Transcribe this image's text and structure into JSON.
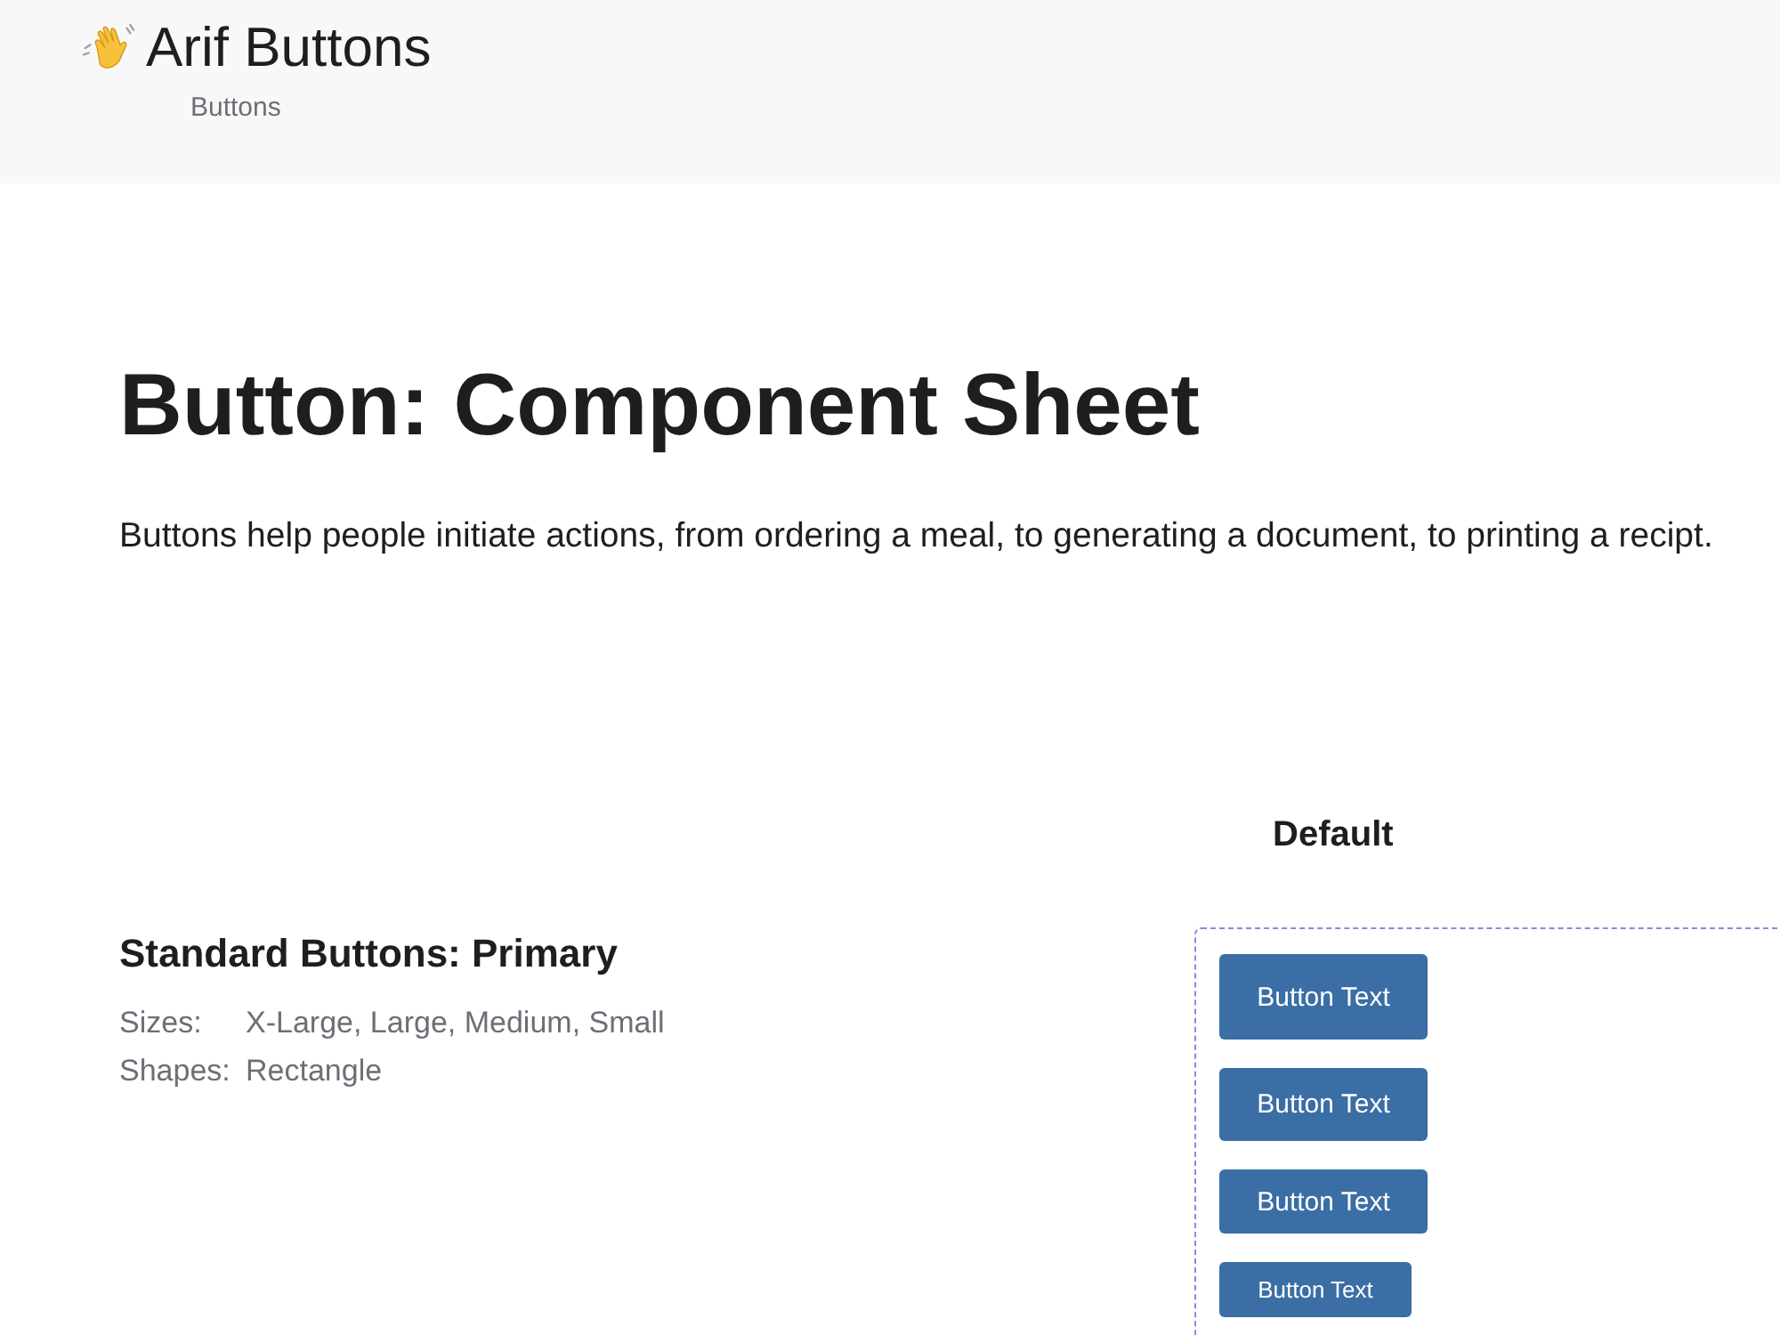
{
  "header": {
    "title": "Arif Buttons",
    "nav_link": "Buttons"
  },
  "page": {
    "title": "Button: Component Sheet",
    "description": "Buttons help people initiate actions, from ordering a meal, to generating a document, to printing a recipt."
  },
  "section": {
    "heading": "Standard Buttons: Primary",
    "specs": [
      {
        "label": "Sizes:",
        "value": "X-Large, Large, Medium, Small"
      },
      {
        "label": "Shapes:",
        "value": "Rectangle"
      }
    ]
  },
  "variant": {
    "title": "Default",
    "buttons": [
      {
        "label": "Button Text",
        "kind": "xlarge"
      },
      {
        "label": "Button Text",
        "kind": "large"
      },
      {
        "label": "Button Text",
        "kind": "medium"
      },
      {
        "label": "Button Text",
        "kind": "small"
      }
    ]
  }
}
